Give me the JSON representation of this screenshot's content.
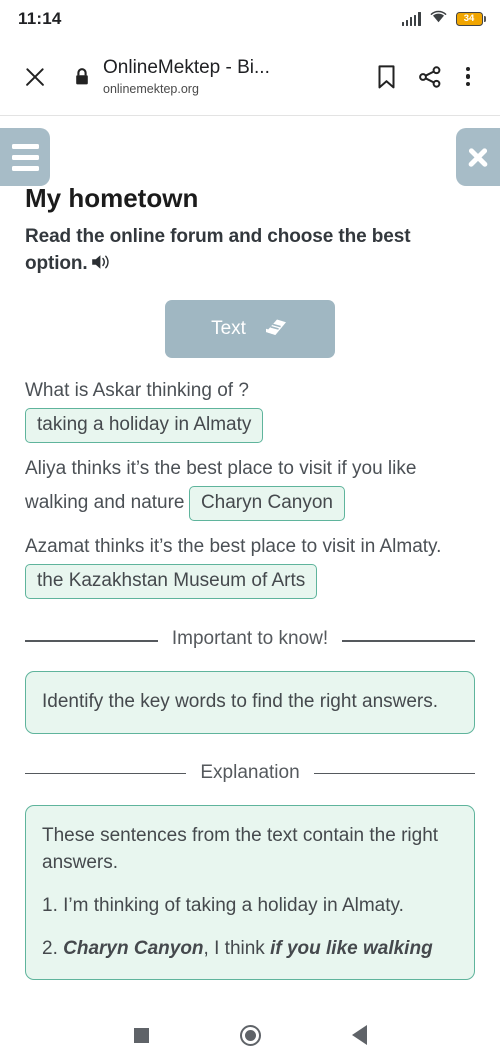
{
  "status_bar": {
    "time": "11:14",
    "battery_level": "34",
    "signal_icon": "cellular-signal-icon",
    "wifi_icon": "wifi-icon",
    "battery_icon": "battery-icon"
  },
  "browser": {
    "close_icon": "close-icon",
    "lock_icon": "lock-icon",
    "title": "OnlineMektep - Bi...",
    "url": "onlinemektep.org",
    "bookmark_icon": "bookmark-icon",
    "share_icon": "share-icon",
    "menu_icon": "overflow-menu-icon"
  },
  "page": {
    "menu_button_icon": "hamburger-menu-icon",
    "close_button_icon": "close-icon",
    "title": "My hometown",
    "prompt": "Read the online forum and choose the best option.",
    "speaker_icon": "speaker-icon",
    "text_button": {
      "label": "Text",
      "icon": "book-icon"
    }
  },
  "questions": [
    {
      "prefix": "What is Askar thinking of ?",
      "answer": "taking a holiday in Almaty",
      "suffix": "",
      "layout": "block"
    },
    {
      "prefix": "Aliya thinks it’s the best place to visit if you like walking and nature",
      "answer": "Charyn Canyon",
      "suffix": "",
      "layout": "inline"
    },
    {
      "prefix": "Azamat thinks it’s the best place to visit in Almaty.",
      "answer": "the Kazakhstan Museum of Arts",
      "suffix": "",
      "layout": "inline"
    }
  ],
  "important": {
    "divider_label": "Important to know!",
    "body": "Identify the key words to find the right answers."
  },
  "explanation": {
    "divider_label": "Explanation",
    "intro": "These sentences from the text contain the right answers.",
    "item_1": "1. I’m thinking of taking a holiday in Almaty.",
    "item_2_number": "2. ",
    "item_2_bold_a": "Charyn Canyon",
    "item_2_mid": ", I think ",
    "item_2_bold_b": "if you like walking"
  },
  "nav_bar": {
    "recents_icon": "square-recents-icon",
    "home_icon": "circle-home-icon",
    "back_icon": "triangle-back-icon"
  },
  "colors": {
    "accent_green": "#5fb49c",
    "answer_fill": "#e8f6ef",
    "button_blue_grey": "#a0b7c2",
    "battery_orange": "#f0a500"
  }
}
